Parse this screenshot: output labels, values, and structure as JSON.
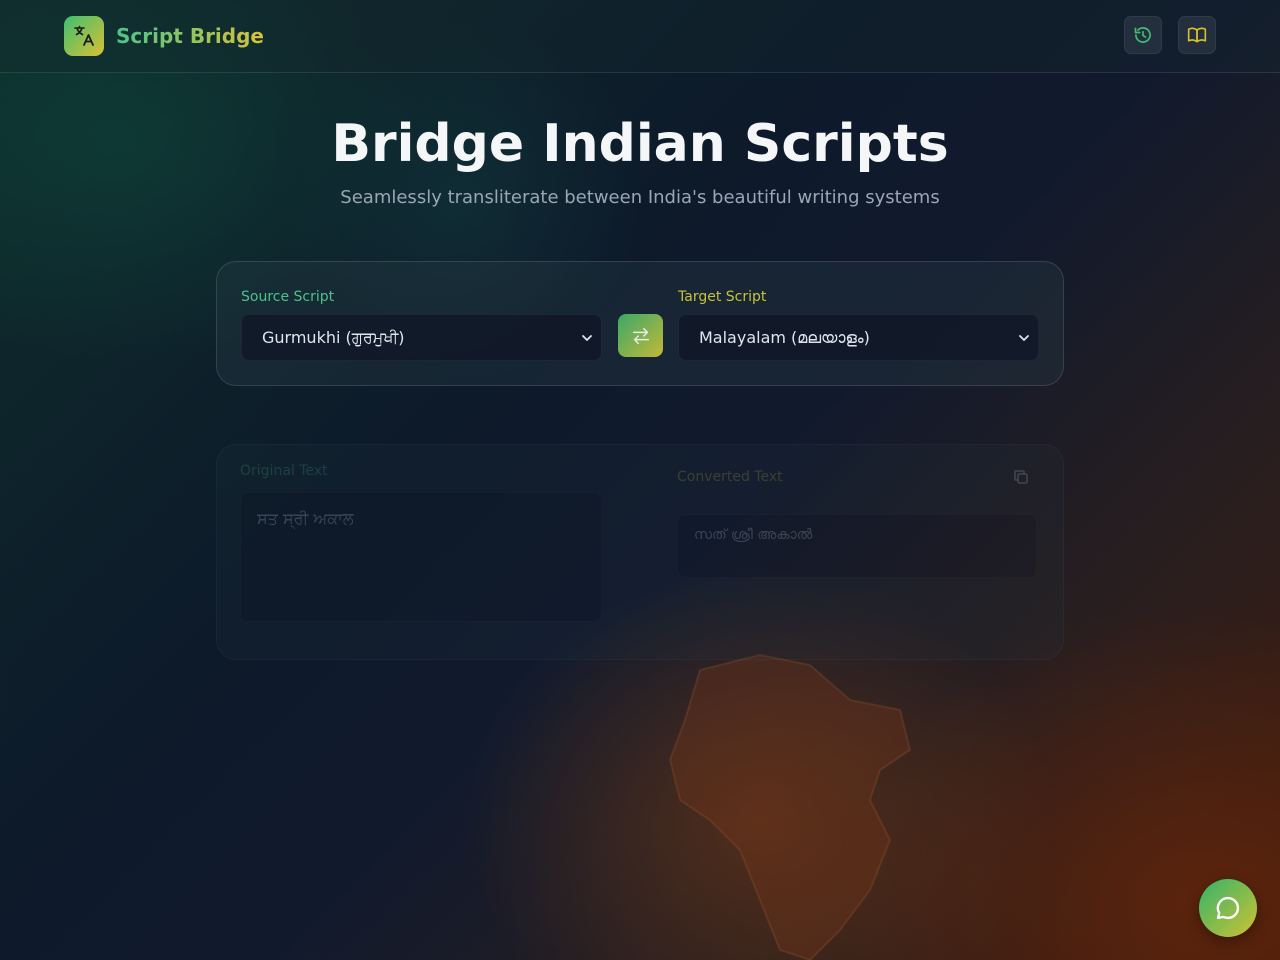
{
  "header": {
    "brand": "Script Bridge",
    "logo_icon": "translate-icon",
    "history_icon": "history-icon",
    "guide_icon": "book-icon"
  },
  "hero": {
    "title": "Bridge Indian Scripts",
    "subtitle": "Seamlessly transliterate between India's beautiful writing systems"
  },
  "selector": {
    "source_label": "Source Script",
    "source_value": "Gurmukhi (ਗੁਰਮੁਖੀ)",
    "target_label": "Target Script",
    "target_value": "Malayalam (മലയാളം)",
    "swap_icon": "swap-arrows-icon"
  },
  "editor": {
    "original_label": "Original Text",
    "original_value": "ਸਤ ਸ੍ਰੀ ਅਕਾਲ",
    "converted_label": "Converted Text",
    "converted_value": "സത് ശ്രീ അകാൽ",
    "copy_icon": "copy-icon"
  },
  "chat": {
    "icon": "chat-bubble-icon"
  },
  "colors": {
    "accent_green": "#3fbf73",
    "accent_gold": "#d9c131"
  }
}
